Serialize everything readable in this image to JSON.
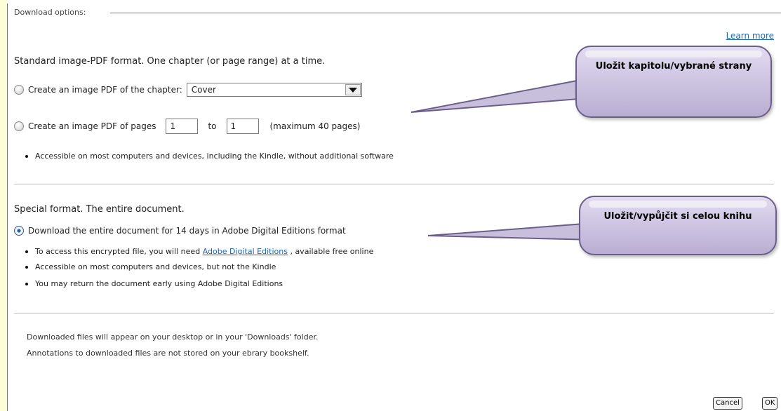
{
  "dialog": {
    "legend": "Download options:",
    "learn_more": "Learn more"
  },
  "standard": {
    "heading": "Standard image-PDF format. One chapter (or page range) at a time.",
    "chapter_label": "Create an image PDF of the chapter:",
    "chapter_selected": "Cover",
    "pages_label": "Create an image PDF of pages",
    "from_value": "1",
    "to_label": "to",
    "to_value": "1",
    "max_note": "(maximum 40 pages)",
    "bullet": "Accessible on most computers and devices, including the Kindle, without additional software"
  },
  "special": {
    "heading": "Special format. The entire document.",
    "download_label": "Download the entire document for 14 days in Adobe Digital Editions format",
    "bullet1_pre": "To access this encrypted file, you will need",
    "bullet1_link": "Adobe Digital Editions",
    "bullet1_post": ", available free online",
    "bullet2": "Accessible on most computers and devices, but not the Kindle",
    "bullet3": "You may return the document early using Adobe Digital Editions"
  },
  "notes": {
    "line1": "Downloaded files will appear on your desktop or in your 'Downloads' folder.",
    "line2": "Annotations to downloaded files are not stored on your ebrary bookshelf."
  },
  "buttons": {
    "cancel": "Cancel",
    "ok": "OK"
  },
  "callouts": {
    "save_chapter": "Uložit kapitolu/vybrané strany",
    "save_book": "Uložit/vypůjčit si celou knihu"
  },
  "colors": {
    "page_background": "#fffdd6",
    "link": "#1b66b3",
    "callout_fill": "#cfc6e3",
    "callout_border": "#6b5f8a"
  }
}
